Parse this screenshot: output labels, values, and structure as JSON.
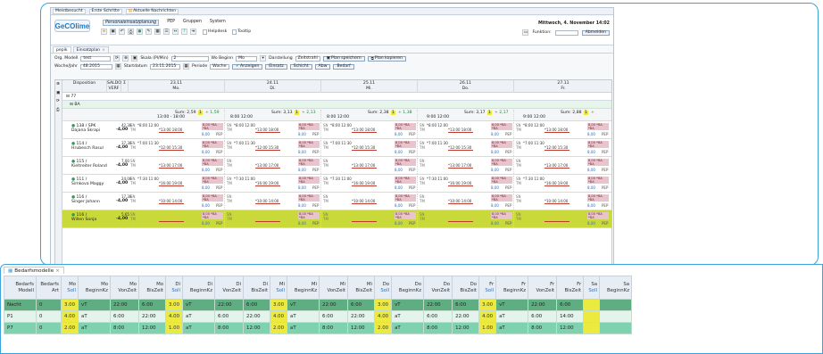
{
  "browser": {
    "bookmarks": [
      "Meistbesucht",
      "Erste Schritte",
      "Aktuelle Nachrichten"
    ]
  },
  "app": {
    "logo_text": "GeCOlime",
    "menu": [
      "Personaleinsatzplanung",
      "PEP",
      "Gruppen",
      "System"
    ],
    "date_time": "Mittwoch, 4. November 14:02",
    "helpdesk_label": "Helpdesk",
    "tooltip_label": "Tooltip",
    "funktion_label": "Funktion:",
    "abmelden_label": "Abmelden"
  },
  "tabs": [
    "pepik",
    "Einsatzplan"
  ],
  "filters": {
    "org_modell_label": "Org. Modell",
    "org_modell_value": "test",
    "skala_label": "Skala (Pl/Min)",
    "skala_value": "2",
    "wo_beginn_label": "Wo Beginn",
    "wo_beginn_value": "Mo",
    "darstellung_label": "Darstellung",
    "darstellung_value": "Zeitstrahl",
    "plan_speichern": "Plan speichern",
    "plan_kopieren": "Plan kopieren",
    "woche_jahr_label": "Woche/Jahr",
    "woche_jahr_value": "48.2015",
    "startdatum_label": "Startdatum",
    "startdatum_value": "23.11.2015",
    "periode_label": "Periode",
    "periode_value": "Woche",
    "anzeigen": "Anzeigen",
    "einsatz": "Einsatz",
    "schicht": "Schicht",
    "abw": "Abw",
    "bedarf": "Bedarf"
  },
  "grid": {
    "col_disposition": "Disposition",
    "col_saldo": "SALDO",
    "col_saldo_sub": "VERF",
    "col_sum_sym": "Σ",
    "days": [
      {
        "date": "23.11",
        "day": "Mo."
      },
      {
        "date": "24.11",
        "day": "Di."
      },
      {
        "date": "25.11",
        "day": "Mi."
      },
      {
        "date": "26.11",
        "day": "Do."
      },
      {
        "date": "27.11",
        "day": "Fr."
      }
    ],
    "tree_root": "77",
    "group": "BA",
    "sum_rows": [
      {
        "sum": "Sum: 2,59",
        "a": "1",
        "b": "+ 1,59",
        "time": "13:00 - 18:00"
      },
      {
        "sum": "Sum: 3,13",
        "a": "1",
        "b": "+ 2,13",
        "time": "8:00 12:00"
      },
      {
        "sum": "Sum: 2,38",
        "a": "1",
        "b": "+ 1,38",
        "time": "8:00 12:00"
      },
      {
        "sum": "Sum: 3,17",
        "a": "1",
        "b": "+ 2,17",
        "time": "9:00 12:00"
      },
      {
        "sum": "Sum: 2,88",
        "a": "1",
        "b": "+",
        "time": "9:00 12:00"
      }
    ],
    "employees": [
      {
        "id": "138 / SPK",
        "name": "Dajana Skrapi",
        "saldo": "-4,00",
        "verf": "42,38",
        "start": "*8:00 12:00",
        "end": "*13:00 18:00"
      },
      {
        "id": "114 /",
        "name": "Hrubesch Rasul",
        "saldo": "-4,00",
        "verf": "37,38",
        "start": "*7:00 11:30",
        "end": "*12:00 15:30"
      },
      {
        "id": "115 /",
        "name": "Kieltreiter Roland",
        "saldo": "-4,00",
        "verf": "7,00",
        "start": "",
        "end": "*13:00 17:00"
      },
      {
        "id": "111 /",
        "name": "Simkova Maggy",
        "saldo": "-4,00",
        "verf": "24,08",
        "start": "*7:30 11:00",
        "end": "*16:00 19:00"
      },
      {
        "id": "116 /",
        "name": "Singer Johann",
        "saldo": "-4,00",
        "verf": "17,38",
        "start": "",
        "end": "*10:00 14:00"
      },
      {
        "id": "116 /",
        "name": "Willen Sonja",
        "saldo": "-4,00",
        "verf": "5,65",
        "start": "",
        "end": ""
      }
    ],
    "pep_tag": "PEP",
    "hours_tag": "8,00",
    "ta_tag": "*BA *BA"
  },
  "lower": {
    "tab_label": "Bedarfsmodelle",
    "headers": [
      {
        "l1": "Bedarfs",
        "l2": "Modell"
      },
      {
        "l1": "Bedarfs",
        "l2": "Art"
      },
      {
        "l1": "Mo",
        "l2": "Soll"
      },
      {
        "l1": "Mo",
        "l2": "BeginnKz"
      },
      {
        "l1": "Mo",
        "l2": "VonZeit"
      },
      {
        "l1": "Mo",
        "l2": "BisZeit"
      },
      {
        "l1": "Di",
        "l2": "Soll"
      },
      {
        "l1": "Di",
        "l2": "BeginnKz"
      },
      {
        "l1": "Di",
        "l2": "VonZeit"
      },
      {
        "l1": "Di",
        "l2": "BisZeit"
      },
      {
        "l1": "Mi",
        "l2": "Soll"
      },
      {
        "l1": "Mi",
        "l2": "BeginnKz"
      },
      {
        "l1": "Mi",
        "l2": "VonZeit"
      },
      {
        "l1": "Mi",
        "l2": "BisZeit"
      },
      {
        "l1": "Do",
        "l2": "Soll"
      },
      {
        "l1": "Do",
        "l2": "BeginnKz"
      },
      {
        "l1": "Do",
        "l2": "VonZeit"
      },
      {
        "l1": "Do",
        "l2": "BisZeit"
      },
      {
        "l1": "Fr",
        "l2": "Soll"
      },
      {
        "l1": "Fr",
        "l2": "BeginnKz"
      },
      {
        "l1": "Fr",
        "l2": "VonZeit"
      },
      {
        "l1": "Fr",
        "l2": "BisZeit"
      },
      {
        "l1": "Sa",
        "l2": "Soll"
      },
      {
        "l1": "Sa",
        "l2": "BeginnKz"
      }
    ],
    "rows": [
      [
        "Nacht",
        "0",
        "3.00",
        "vT",
        "22:00",
        "6:00",
        "3.00",
        "vT",
        "22:00",
        "6:00",
        "3.00",
        "vT",
        "22:00",
        "6:00",
        "3.00",
        "vT",
        "22:00",
        "6:00",
        "3.00",
        "vT",
        "22:00",
        "6:00",
        "",
        ""
      ],
      [
        "P1",
        "0",
        "4.00",
        "aT",
        "6:00",
        "22:00",
        "4.00",
        "aT",
        "6:00",
        "22:00",
        "4.00",
        "aT",
        "6:00",
        "22:00",
        "4.00",
        "aT",
        "6:00",
        "22:00",
        "4.00",
        "aT",
        "6:00",
        "14:00",
        "",
        ""
      ],
      [
        "P7",
        "0",
        "2.00",
        "aT",
        "8:00",
        "12:00",
        "1.00",
        "aT",
        "8:00",
        "12:00",
        "2.00",
        "aT",
        "8:00",
        "12:00",
        "2.00",
        "aT",
        "8:00",
        "12:00",
        "1.00",
        "aT",
        "8:00",
        "12:00",
        "",
        ""
      ]
    ]
  },
  "colors": {
    "accent": "#3aa4dc",
    "green": "#68c89e",
    "yellow": "#ecea3e",
    "pink": "#e8c4cc"
  }
}
